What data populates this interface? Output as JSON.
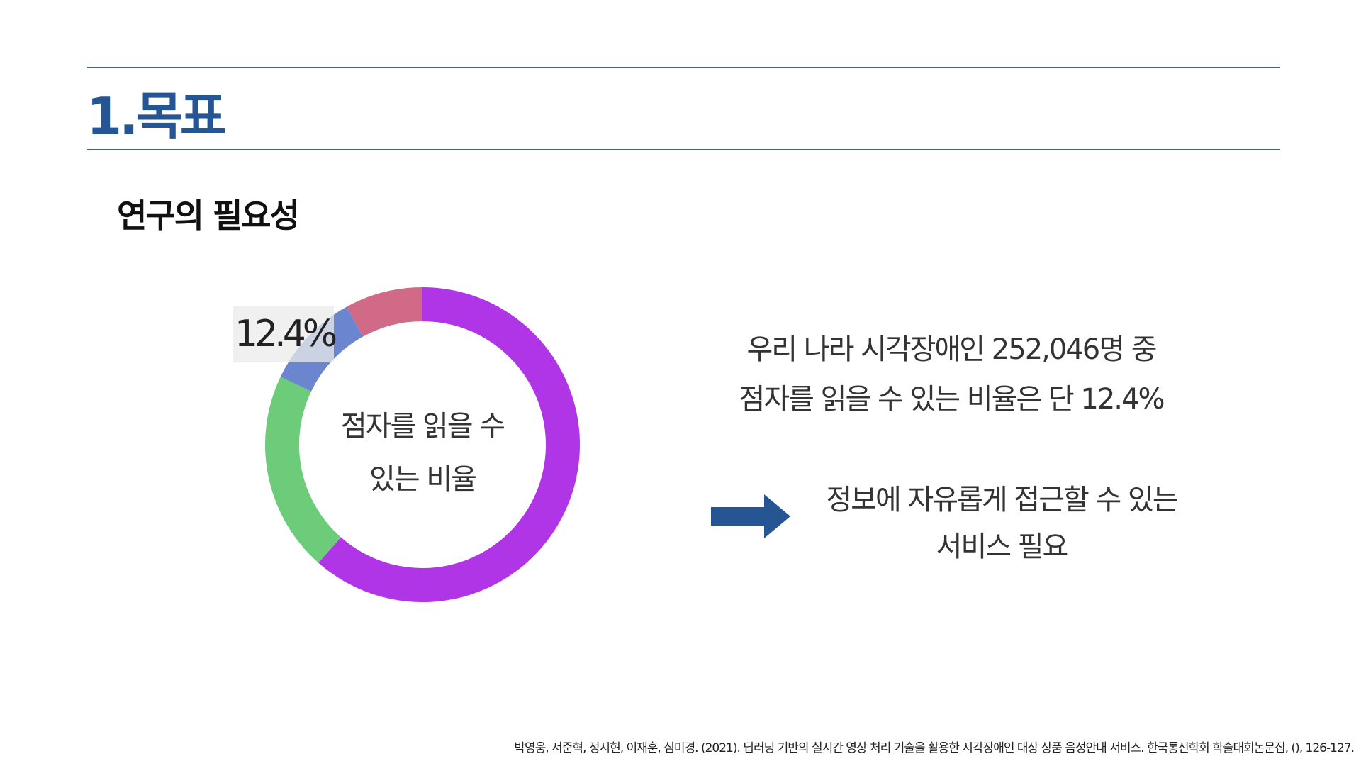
{
  "header": {
    "title": "1.목표"
  },
  "section": {
    "subtitle": "연구의 필요성"
  },
  "chart_data": {
    "type": "pie",
    "donut": true,
    "values": [
      61.5,
      20.6,
      9.9,
      8.0
    ],
    "colors": [
      "#b035e6",
      "#6ccc7a",
      "#6b86cf",
      "#d06a86"
    ],
    "center_label": [
      "점자를 읽을 수",
      "있는 비율"
    ],
    "annotation": "12.4%"
  },
  "statement": {
    "line1": "우리 나라 시각장애인 252,046명 중",
    "line2": "점자를 읽을 수 있는 비율은 단 12.4%"
  },
  "conclusion": {
    "arrow_color": "#255593",
    "line1": "정보에 자유롭게 접근할 수 있는",
    "line2": "서비스 필요"
  },
  "citation": "박영웅, 서준혁, 정시현, 이재훈, 심미경. (2021). 딥러닝 기반의 실시간 영상 처리 기술을 활용한 시각장애인 대상 상품 음성안내 서비스. 한국통신학회 학술대회논문집, (), 126-127."
}
